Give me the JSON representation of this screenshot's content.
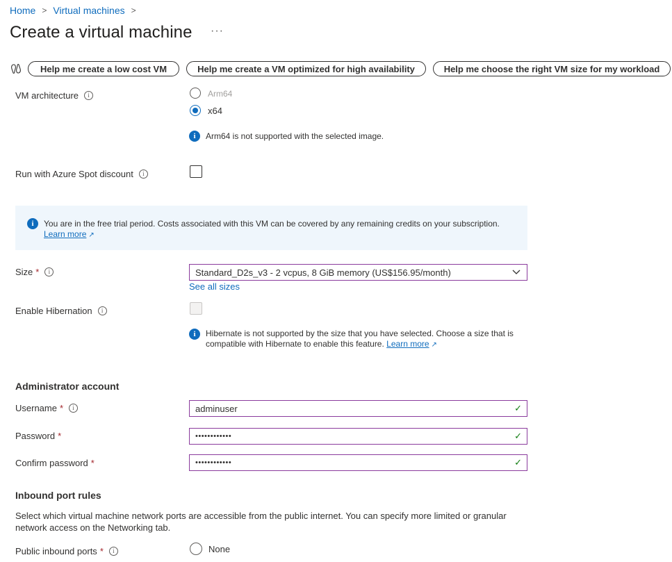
{
  "breadcrumb": {
    "items": [
      "Home",
      "Virtual machines"
    ]
  },
  "title": "Create a virtual machine",
  "title_more": "···",
  "help_buttons": [
    "Help me create a low cost VM",
    "Help me create a VM optimized for high availability",
    "Help me choose the right VM size for my workload"
  ],
  "vm_architecture": {
    "label": "VM architecture",
    "options": [
      "Arm64",
      "x64"
    ],
    "selected": "x64",
    "note": "Arm64 is not supported with the selected image."
  },
  "spot": {
    "label": "Run with Azure Spot discount",
    "checked": false
  },
  "trial_banner": {
    "text": "You are in the free trial period. Costs associated with this VM can be covered by any remaining credits on your subscription.",
    "link": "Learn more"
  },
  "size": {
    "label": "Size",
    "value": "Standard_D2s_v3 - 2 vcpus, 8 GiB memory (US$156.95/month)",
    "see_all": "See all sizes"
  },
  "hibernation": {
    "label": "Enable Hibernation",
    "note_line1": "Hibernate is not supported by the size that you have selected. Choose a size that is",
    "note_line2": "compatible with Hibernate to enable this feature.",
    "link": "Learn more"
  },
  "admin": {
    "heading": "Administrator account",
    "username_label": "Username",
    "username_value": "adminuser",
    "password_label": "Password",
    "password_value": "••••••••••••",
    "confirm_label": "Confirm password",
    "confirm_value": "••••••••••••"
  },
  "inbound": {
    "heading": "Inbound port rules",
    "desc_line1": "Select which virtual machine network ports are accessible from the public internet. You can specify more limited or granular",
    "desc_line2": "network access on the Networking tab.",
    "public_label": "Public inbound ports",
    "option_none": "None"
  },
  "required_mark": "*",
  "info_glyph": "i",
  "colors": {
    "accent": "#0f6cbd",
    "valid": "#107c10",
    "required": "#a4262c",
    "banner": "#eff6fc",
    "field_border": "#8a3a9c"
  }
}
